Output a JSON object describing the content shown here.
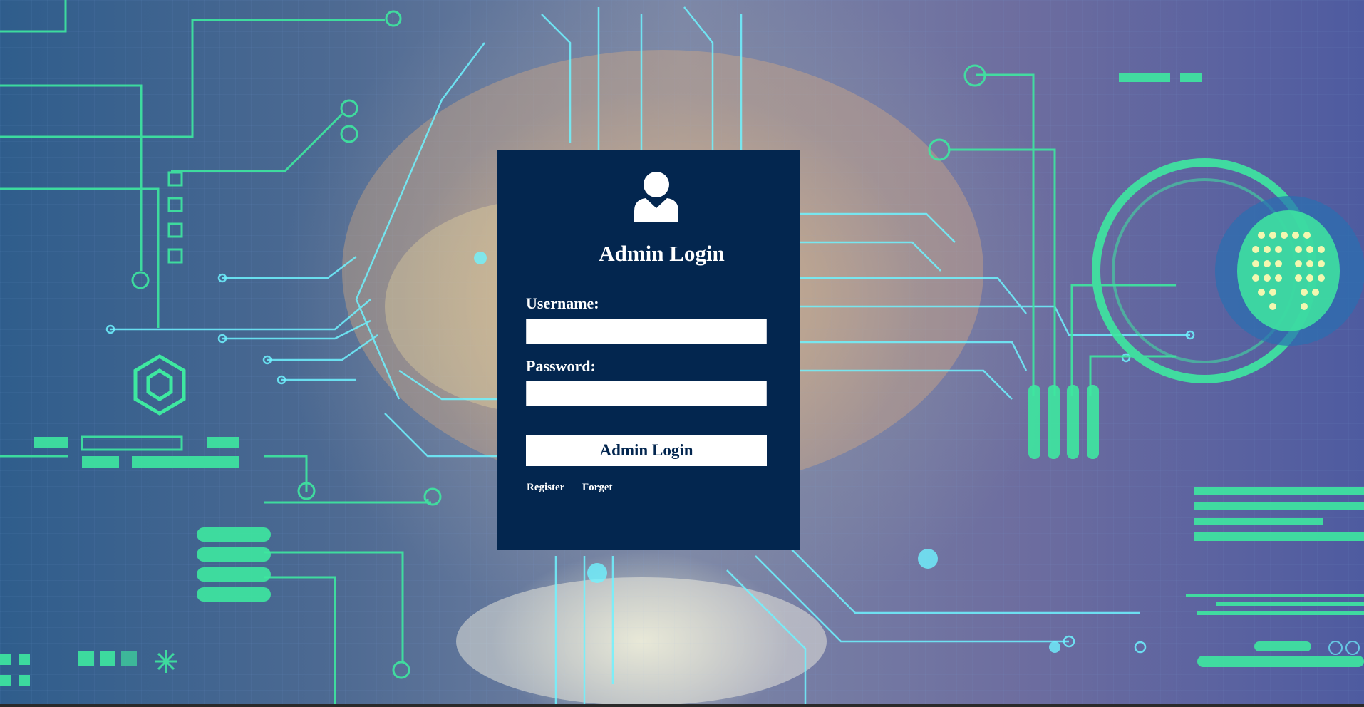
{
  "login": {
    "title": "Admin Login",
    "username_label": "Username:",
    "username_value": "",
    "password_label": "Password:",
    "password_value": "",
    "submit_label": "Admin Login",
    "register_link": "Register",
    "forget_link": "Forget",
    "icon": "user-icon"
  },
  "colors": {
    "card_background": "#03264f",
    "button_background": "#ffffff",
    "circuit_green": "#3ee8a0",
    "circuit_cyan": "#6ff3ff"
  }
}
